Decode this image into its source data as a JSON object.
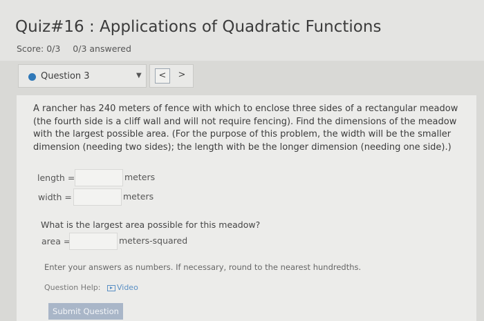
{
  "header": {
    "title": "Quiz#16 : Applications of Quadratic Functions",
    "score": "Score: 0/3",
    "answered": "0/3 answered"
  },
  "question_nav": {
    "current": "Question 3",
    "caret": "▼",
    "prev": "<",
    "next": ">"
  },
  "problem": {
    "text": "A rancher has 240 meters of fence with which to enclose three sides of a rectangular meadow (the fourth side is a cliff wall and will not require fencing). Find the dimensions of the meadow with the largest possible area. (For the purpose of this problem, the width will be the smaller dimension (needing two sides); the length with be the longer dimension (needing one side).)"
  },
  "fields": {
    "length": {
      "label": "length =",
      "value": "",
      "unit": "meters"
    },
    "width": {
      "label": "width =",
      "value": "",
      "unit": "meters"
    },
    "area": {
      "label": "area =",
      "value": "",
      "unit": "meters-squared"
    }
  },
  "area_question": "What is the largest area possible for this meadow?",
  "note": "Enter your answers as numbers. If necessary, round to the nearest hundredths.",
  "help": {
    "label": "Question Help:",
    "video": "Video"
  },
  "submit": "Submit Question",
  "colors": {
    "accent_dot": "#2f78b8",
    "submit_bg": "#a9b6c8",
    "link": "#5a8fc4"
  }
}
